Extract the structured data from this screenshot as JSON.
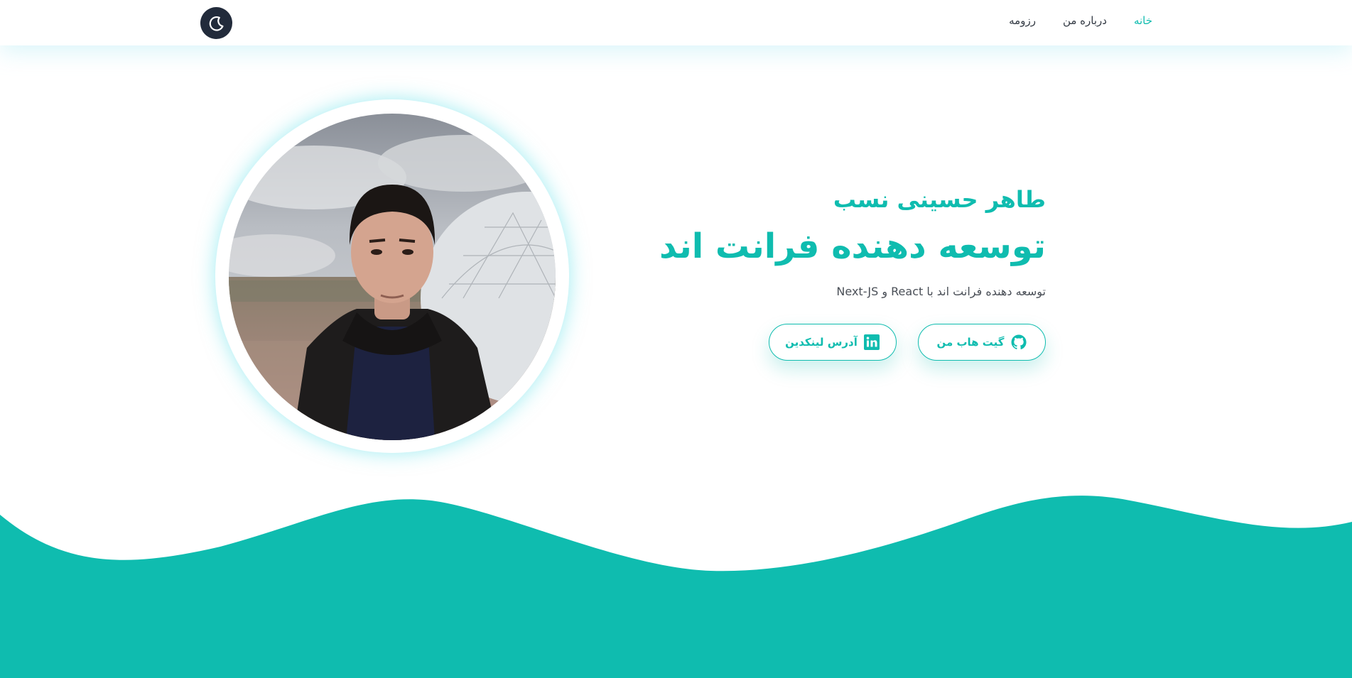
{
  "header": {
    "nav": [
      {
        "label": "خانه",
        "active": true
      },
      {
        "label": "درباره من",
        "active": false
      },
      {
        "label": "رزومه",
        "active": false
      }
    ],
    "theme_toggle_icon": "moon-icon"
  },
  "hero": {
    "name": "طاهر حسینی نسب",
    "title": "توسعه دهنده فرانت اند",
    "subtitle": "توسعه دهنده فرانت اند با React و Next-JS",
    "buttons": {
      "github": {
        "label": "گیت هاب من",
        "icon": "github-icon"
      },
      "linkedin": {
        "label": "آدرس لینکدین",
        "icon": "linkedin-icon"
      }
    }
  },
  "colors": {
    "accent": "#0fbcaf",
    "dark": "#222b3b",
    "text": "#333a44"
  }
}
